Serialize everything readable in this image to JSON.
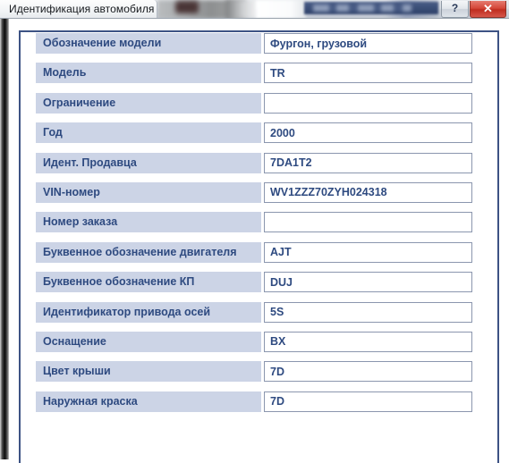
{
  "window": {
    "title": "Идентификация автомобиля",
    "help_button_label": "?",
    "close_button_label": "✕",
    "frame_border_color": "#3d5384",
    "label_bg_color": "#ccd4e6",
    "text_color": "#2e4a80"
  },
  "form": {
    "rows": [
      {
        "label": "Обозначение модели",
        "value": "Фургон, грузовой"
      },
      {
        "label": "Модель",
        "value": "TR"
      },
      {
        "label": "Ограничение",
        "value": ""
      },
      {
        "label": "Год",
        "value": "2000"
      },
      {
        "label": "Идент. Продавца",
        "value": "7DA1T2"
      },
      {
        "label": "VIN-номер",
        "value": "WV1ZZZ70ZYH024318"
      },
      {
        "label": "Номер заказа",
        "value": ""
      },
      {
        "label": "Буквенное обозначение двигателя",
        "value": "AJT"
      },
      {
        "label": "Буквенное обозначение КП",
        "value": "DUJ"
      },
      {
        "label": "Идентификатор привода осей",
        "value": "5S"
      },
      {
        "label": "Оснащение",
        "value": "BX"
      },
      {
        "label": "Цвет крыши",
        "value": "7D"
      },
      {
        "label": "Наружная краска",
        "value": "7D"
      }
    ]
  }
}
